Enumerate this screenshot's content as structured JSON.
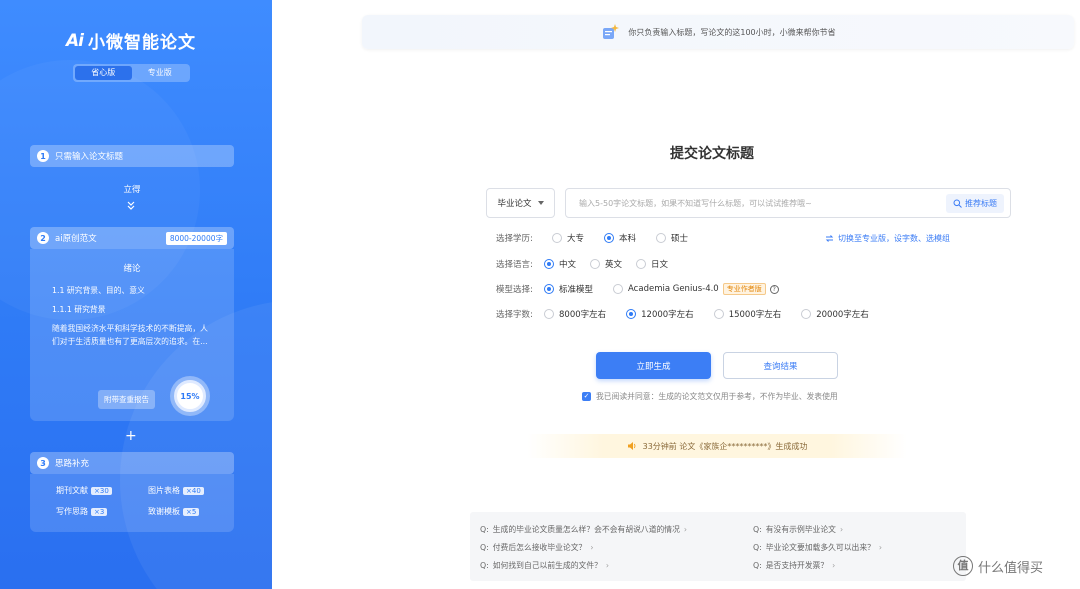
{
  "sidebar": {
    "brand_mark": "Ai",
    "brand_name": "小微智能论文",
    "modes": [
      "省心版",
      "专业版"
    ],
    "step1": {
      "num": "1",
      "label": "只需输入论文标题"
    },
    "step1_result": "立得",
    "step2": {
      "num": "2",
      "label": "ai原创范文",
      "tag": "8000-20000字"
    },
    "sample": {
      "title": "绪论",
      "h1": "1.1 研究背景、目的、意义",
      "h2": "1.1.1 研究背景",
      "para": "随着我国经济水平和科学技术的不断提高，人们对于生活质量也有了更高层次的追求。在...",
      "report_label": "附带查重报告",
      "percent": "15%"
    },
    "plus": "+",
    "step3": {
      "num": "3",
      "label": "思路补充"
    },
    "extras": [
      {
        "label": "期刊文献",
        "count": "×30"
      },
      {
        "label": "图片表格",
        "count": "×40"
      },
      {
        "label": "写作思路",
        "count": "×3"
      },
      {
        "label": "致谢模板",
        "count": "×5"
      }
    ]
  },
  "notice": {
    "text": "你只负责输入标题，写论文的这100小时，小微来帮你节省"
  },
  "page_title": "提交论文标题",
  "form": {
    "type_select": "毕业论文",
    "title_placeholder": "输入5-50字论文标题，如果不知道写什么标题，可以试试推荐哦~",
    "recommend_label": "推荐标题",
    "switch_link": "切换至专业版，设字数、选模组",
    "education": {
      "label": "选择学历:",
      "options": [
        "大专",
        "本科",
        "硕士"
      ],
      "selected": "本科"
    },
    "language": {
      "label": "选择语言:",
      "options": [
        "中文",
        "英文",
        "日文"
      ],
      "selected": "中文"
    },
    "model": {
      "label": "模型选择:",
      "options": [
        "标准模型",
        "Academia Genius-4.0"
      ],
      "selected": "标准模型",
      "pro_tag": "专业作者版"
    },
    "words": {
      "label": "选择字数:",
      "options": [
        "8000字左右",
        "12000字左右",
        "15000字左右",
        "20000字左右"
      ],
      "selected": "12000字左右"
    },
    "generate_label": "立即生成",
    "query_label": "查询结果",
    "agree_text": "我已阅读并同意：生成的论文范文仅用于参考，不作为毕业、发表使用"
  },
  "success": {
    "text": "33分钟前 论文《家族企**********》生成成功"
  },
  "faq": [
    "生成的毕业论文质量怎么样？会不会有胡说八道的情况",
    "有没有示例毕业论文",
    "付费后怎么接收毕业论文？",
    "毕业论文要加载多久可以出来？",
    "如何找到自己以前生成的文件？",
    "是否支持开发票？"
  ],
  "faq_prefix": "Q:",
  "watermark": {
    "icon": "值",
    "text": "什么值得买"
  },
  "colors": {
    "primary": "#3c7ef5",
    "sidebar_top": "#3f8cff",
    "sidebar_bottom": "#2a6ff0"
  }
}
